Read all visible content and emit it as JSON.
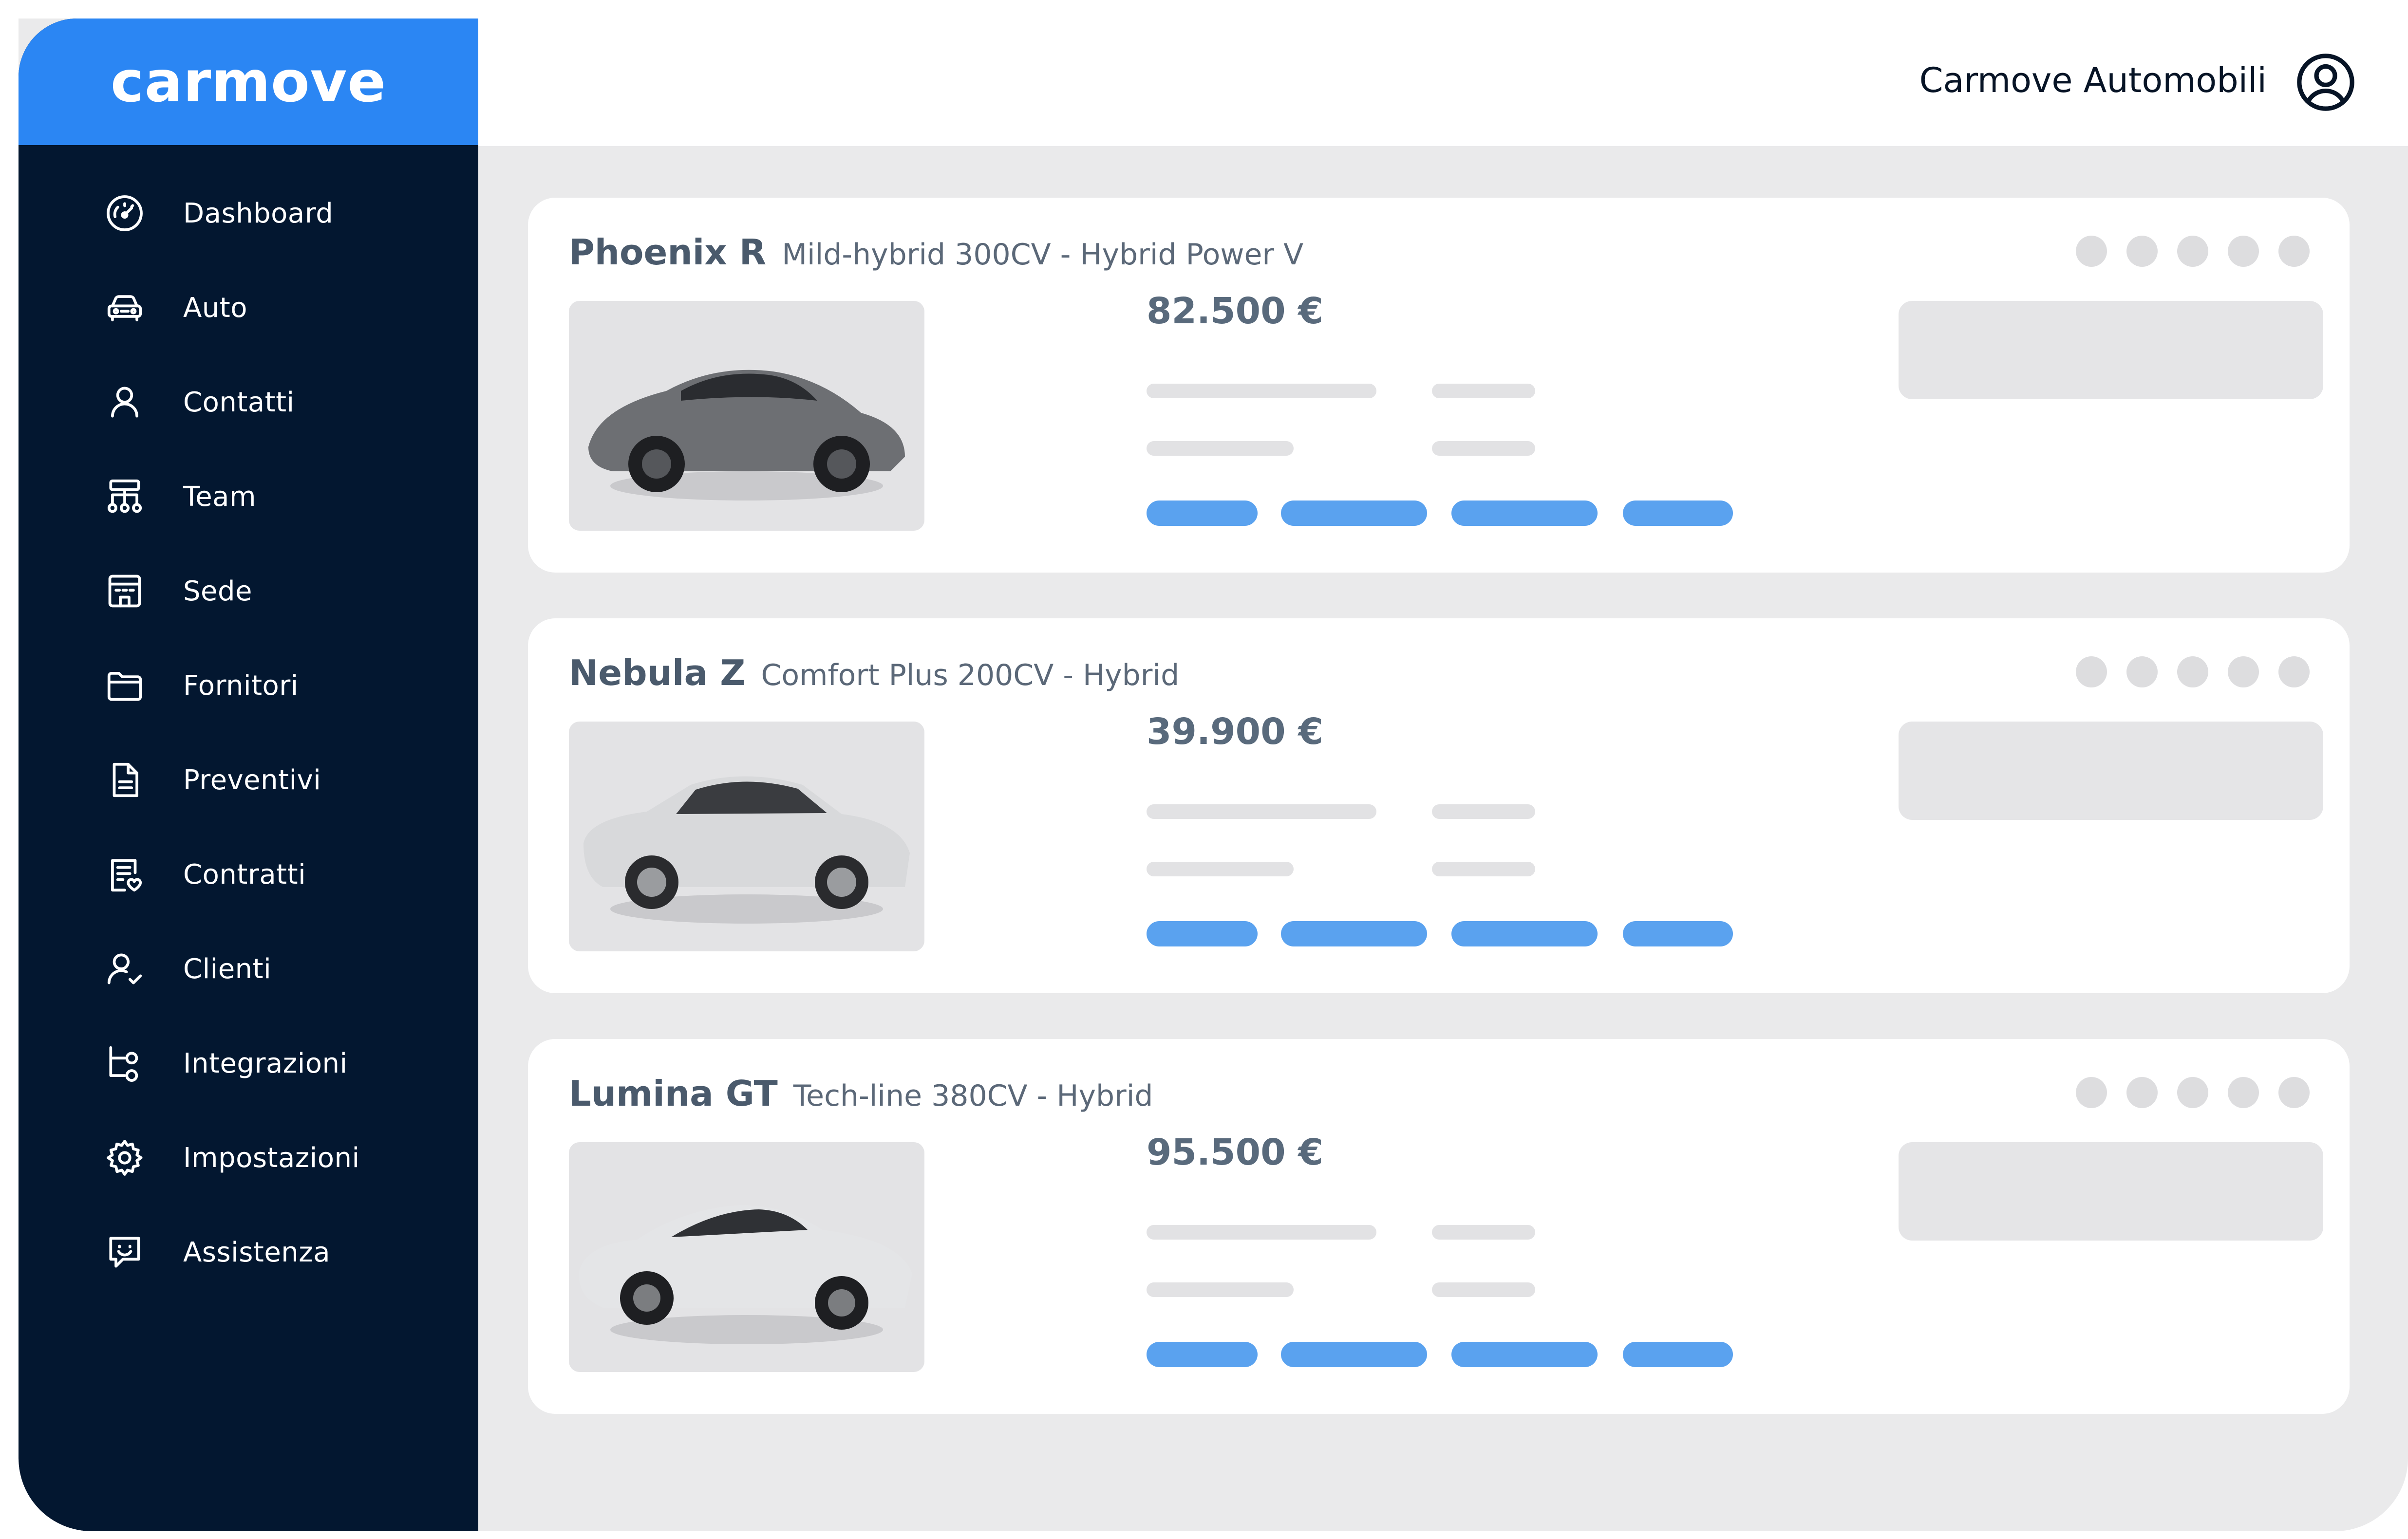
{
  "brand": {
    "logo": "carmove",
    "accent_color": "#2b86f3",
    "sidebar_color": "#031730"
  },
  "header": {
    "company_name": "Carmove Automobili",
    "account_icon": "account-circle-icon"
  },
  "sidebar": {
    "items": [
      {
        "label": "Dashboard",
        "icon": "speedometer-icon"
      },
      {
        "label": "Auto",
        "icon": "car-icon"
      },
      {
        "label": "Contatti",
        "icon": "person-icon"
      },
      {
        "label": "Team",
        "icon": "org-chart-icon"
      },
      {
        "label": "Sede",
        "icon": "building-icon"
      },
      {
        "label": "Fornitori",
        "icon": "folder-icon"
      },
      {
        "label": "Preventivi",
        "icon": "document-icon"
      },
      {
        "label": "Contratti",
        "icon": "contract-icon"
      },
      {
        "label": "Clienti",
        "icon": "client-check-icon"
      },
      {
        "label": "Integrazioni",
        "icon": "integration-icon"
      },
      {
        "label": "Impostazioni",
        "icon": "gear-icon"
      },
      {
        "label": "Assistenza",
        "icon": "chat-smile-icon"
      }
    ]
  },
  "cars": [
    {
      "name": "Phoenix R",
      "variant": "Mild-hybrid 300CV - Hybrid Power V",
      "price": "82.500 €",
      "paint": "#6d6f73"
    },
    {
      "name": "Nebula Z",
      "variant": "Comfort Plus 200CV - Hybrid",
      "price": "39.900 €",
      "paint": "#d8d9db"
    },
    {
      "name": "Lumina GT",
      "variant": "Tech-line 380CV - Hybrid",
      "price": "95.500 €",
      "paint": "#e4e5e7"
    }
  ],
  "colors": {
    "tag": "#5aa2ef",
    "skeleton": "#e2e2e4",
    "dot": "#dddddf"
  }
}
